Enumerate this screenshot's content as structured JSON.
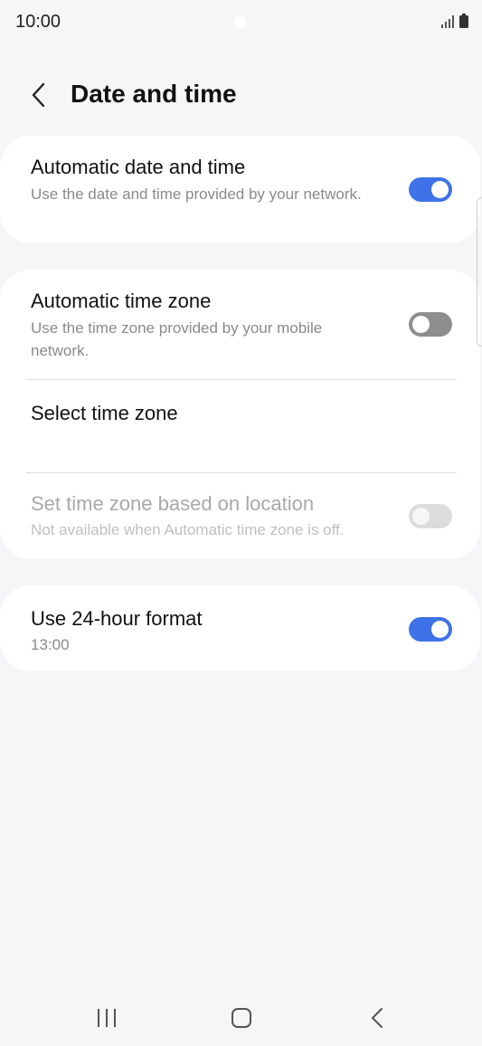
{
  "status_bar": {
    "time": "10:00"
  },
  "header": {
    "title": "Date and time",
    "back_icon": "chevron-left-icon"
  },
  "sections": {
    "auto_date_time": {
      "title": "Automatic date and time",
      "subtitle": "Use the date and time provided by your network.",
      "toggle": "on"
    },
    "auto_time_zone": {
      "title": "Automatic time zone",
      "subtitle": "Use the time zone provided by your mobile network.",
      "toggle": "off"
    },
    "select_time_zone": {
      "title": "Select time zone"
    },
    "location_time_zone": {
      "title": "Set time zone based on location",
      "subtitle": "Not available when Automatic time zone is off.",
      "toggle": "disabled"
    },
    "hour_format": {
      "title": "Use 24-hour format",
      "subtitle": "13:00",
      "toggle": "on"
    }
  },
  "colors": {
    "accent": "#3e72e6",
    "background": "#f6f6f8",
    "card": "#ffffff",
    "subtitle": "#8a8a8a"
  },
  "nav_bar": {
    "icons": [
      "recent-apps-icon",
      "home-icon",
      "back-icon"
    ]
  }
}
